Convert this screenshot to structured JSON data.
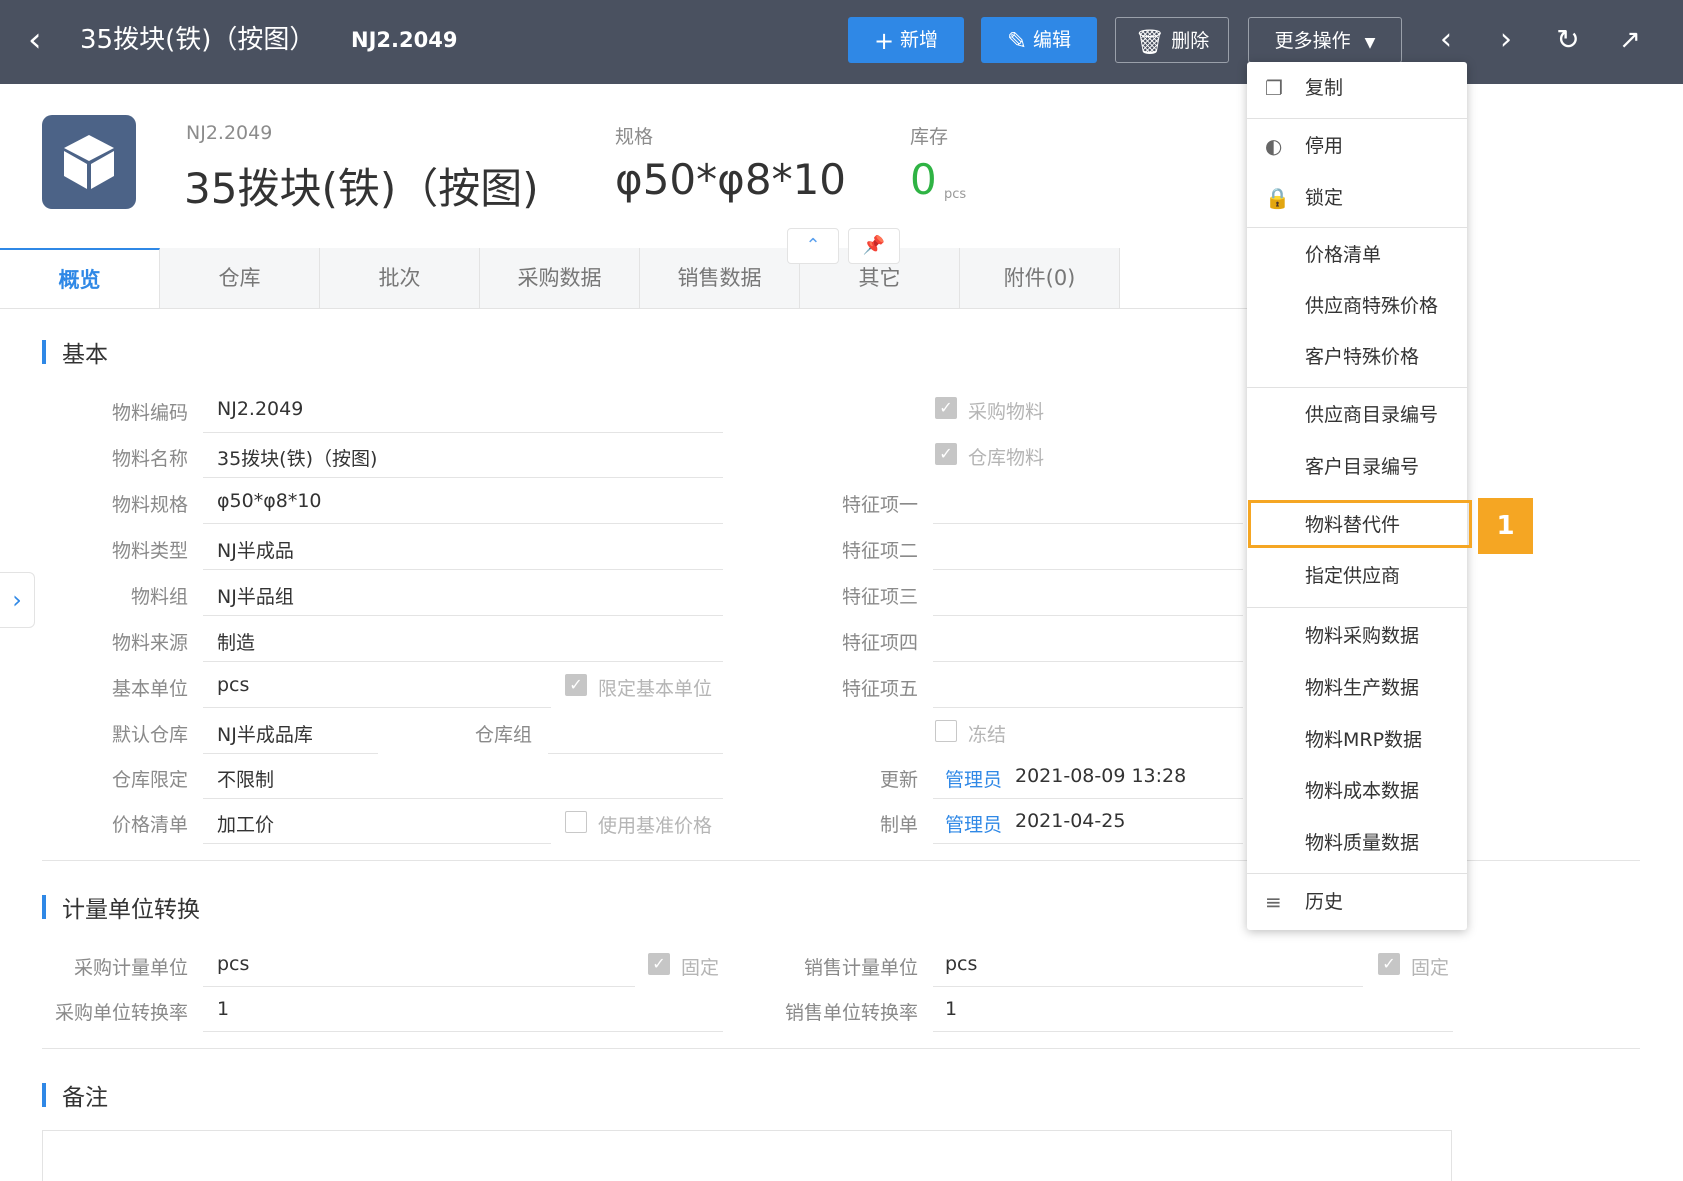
{
  "topbar": {
    "title": "35拨块(铁)（按图）",
    "code": "NJ2.2049",
    "buttons": {
      "add": "新增",
      "edit": "编辑",
      "delete": "删除",
      "more": "更多操作"
    }
  },
  "header": {
    "code_label": "NJ2.2049",
    "name": "35拨块(铁)（按图)",
    "spec_label": "规格",
    "spec_value": "φ50*φ8*10",
    "stock_label": "库存",
    "stock_value": "0",
    "stock_unit": "pcs"
  },
  "tabs": [
    "概览",
    "仓库",
    "批次",
    "采购数据",
    "销售数据",
    "其它",
    "附件(0)"
  ],
  "sections": {
    "basic": "基本",
    "uom": "计量单位转换",
    "remark": "备注"
  },
  "fields": {
    "material_code": {
      "label": "物料编码",
      "value": "NJ2.2049"
    },
    "material_name": {
      "label": "物料名称",
      "value": "35拨块(铁)（按图)"
    },
    "material_spec": {
      "label": "物料规格",
      "value": "φ50*φ8*10"
    },
    "material_type": {
      "label": "物料类型",
      "value": "NJ半成品"
    },
    "material_group": {
      "label": "物料组",
      "value": "NJ半品组"
    },
    "material_source": {
      "label": "物料来源",
      "value": "制造"
    },
    "base_unit": {
      "label": "基本单位",
      "value": "pcs"
    },
    "default_wh": {
      "label": "默认仓库",
      "value": "NJ半成品库"
    },
    "wh_group": {
      "label": "仓库组",
      "value": ""
    },
    "wh_limit": {
      "label": "仓库限定",
      "value": "不限制"
    },
    "price_list": {
      "label": "价格清单",
      "value": "加工价"
    },
    "feature1": {
      "label": "特征项一",
      "value": ""
    },
    "feature2": {
      "label": "特征项二",
      "value": ""
    },
    "feature3": {
      "label": "特征项三",
      "value": ""
    },
    "feature4": {
      "label": "特征项四",
      "value": ""
    },
    "feature5": {
      "label": "特征项五",
      "value": ""
    },
    "updated": {
      "label": "更新",
      "user": "管理员",
      "time": "2021-08-09 13:28"
    },
    "created": {
      "label": "制单",
      "user": "管理员",
      "time": "2021-04-25"
    }
  },
  "checkboxes": {
    "purchase_material": {
      "label": "采购物料",
      "checked": true
    },
    "stock_material": {
      "label": "仓库物料",
      "checked": true
    },
    "limit_base_unit": {
      "label": "限定基本单位",
      "checked": true
    },
    "use_base_price": {
      "label": "使用基准价格",
      "checked": false
    },
    "frozen": {
      "label": "冻结",
      "checked": false
    }
  },
  "uom": {
    "purchase_unit_label": "采购计量单位",
    "purchase_unit": "pcs",
    "purchase_rate_label": "采购单位转换率",
    "purchase_rate": "1",
    "sales_unit_label": "销售计量单位",
    "sales_unit": "pcs",
    "sales_rate_label": "销售单位转换率",
    "sales_rate": "1",
    "fixed_label": "固定"
  },
  "dropdown": {
    "copy": "复制",
    "disable": "停用",
    "lock": "锁定",
    "price_list": "价格清单",
    "supplier_special_price": "供应商特殊价格",
    "customer_special_price": "客户特殊价格",
    "supplier_catalog_no": "供应商目录编号",
    "customer_catalog_no": "客户目录编号",
    "material_substitute": "物料替代件",
    "designated_supplier": "指定供应商",
    "purchase_data": "物料采购数据",
    "production_data": "物料生产数据",
    "mrp_data": "物料MRP数据",
    "cost_data": "物料成本数据",
    "quality_data": "物料质量数据",
    "history": "历史"
  },
  "annotation": {
    "badge": "1"
  },
  "colors": {
    "topbar": "#4a5160",
    "primary": "#2f88e6",
    "highlight": "#f5a623",
    "stock": "#2fb344"
  }
}
